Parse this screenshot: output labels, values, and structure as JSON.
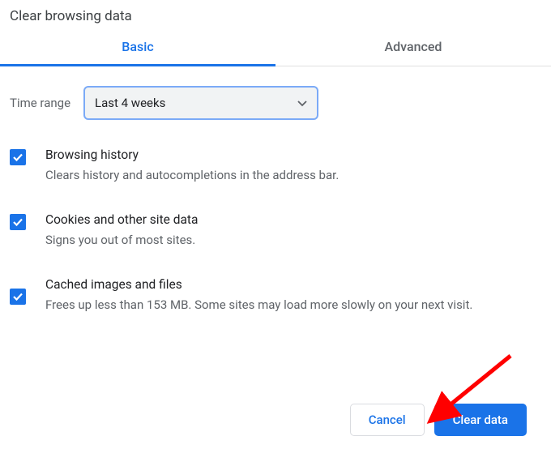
{
  "title": "Clear browsing data",
  "tabs": {
    "basic": "Basic",
    "advanced": "Advanced"
  },
  "time": {
    "label": "Time range",
    "value": "Last 4 weeks"
  },
  "options": [
    {
      "title": "Browsing history",
      "desc": "Clears history and autocompletions in the address bar."
    },
    {
      "title": "Cookies and other site data",
      "desc": "Signs you out of most sites."
    },
    {
      "title": "Cached images and files",
      "desc": "Frees up less than 153 MB. Some sites may load more slowly on your next visit."
    }
  ],
  "buttons": {
    "cancel": "Cancel",
    "clear": "Clear data"
  },
  "colors": {
    "accent": "#1a73e8",
    "arrow": "#ff0000"
  }
}
